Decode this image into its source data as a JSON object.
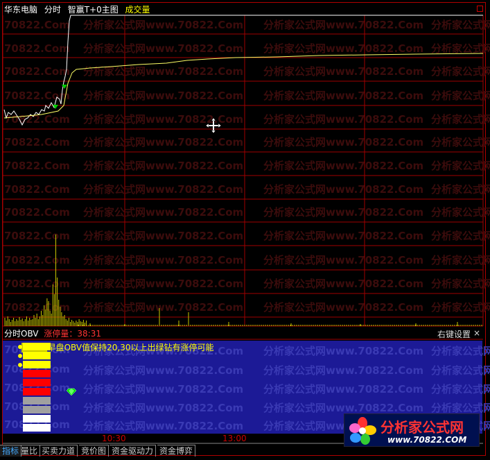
{
  "header": {
    "software": "华东电脑",
    "mode": "分时",
    "main_indicator": "智赢T+0主图",
    "volume_label": "成交量"
  },
  "watermark": {
    "text_cn": "分析家公式网",
    "text_url": "www.70822.Com",
    "text_url_short": "70822.Com"
  },
  "sub_panel": {
    "name": "分时OBV",
    "limit_label": "涨停量",
    "limit_value": "38:31",
    "right_click": "右键设置",
    "close": "×"
  },
  "obv_panel": {
    "badge": "38:31",
    "tip": "早盘OBV值保持20,30以上出绿钻有涨停可能",
    "bars": [
      {
        "color": "#ffff00"
      },
      {
        "color": "#ffff00"
      },
      {
        "color": "#ffff00"
      },
      {
        "color": "#ff0000"
      },
      {
        "color": "#ff0000"
      },
      {
        "color": "#ff0000"
      },
      {
        "color": "#a0a0a0"
      },
      {
        "color": "#a0a0a0"
      },
      {
        "color": "#ffffff"
      },
      {
        "color": "#ffffff"
      }
    ]
  },
  "time_axis": [
    "10:30",
    "13:00"
  ],
  "tabs": [
    "指标",
    "量比",
    "买卖力道",
    "竞价图",
    "资金驱动力",
    "资金博弈"
  ],
  "logo": {
    "name": "分析家公式网",
    "url": "www.70822.COM"
  },
  "colors": {
    "grid": "#a00000",
    "price_line": "#ffffff",
    "avg_line": "#ffff66",
    "volume": "#c8c800",
    "signal": "#00cc00",
    "panel_bg": "#1c1a96"
  }
}
